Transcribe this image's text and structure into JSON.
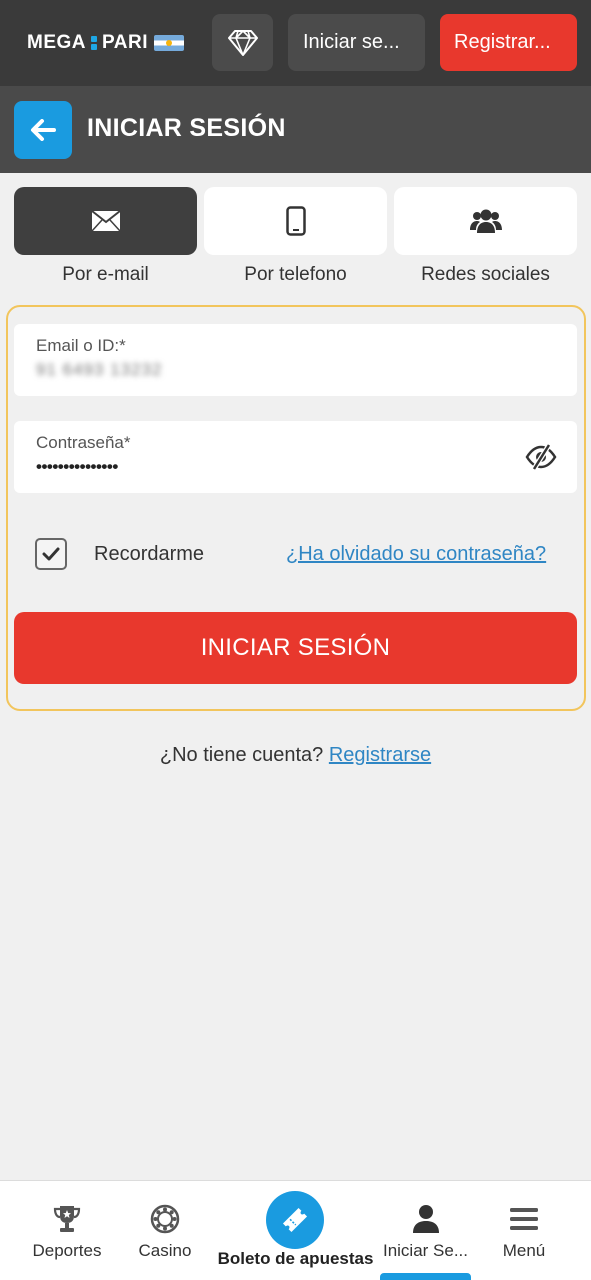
{
  "topbar": {
    "logo_left": "MEGA",
    "logo_right": "PARI",
    "login_label": "Iniciar se...",
    "register_label": "Registrar..."
  },
  "header": {
    "title": "INICIAR SESIÓN"
  },
  "tabs": [
    {
      "label": "Por e-mail",
      "icon": "envelope-icon",
      "active": true
    },
    {
      "label": "Por telefono",
      "icon": "phone-icon",
      "active": false
    },
    {
      "label": "Redes sociales",
      "icon": "users-icon",
      "active": false
    }
  ],
  "form": {
    "email_label": "Email o ID:*",
    "email_value": "91 6493 13232",
    "password_label": "Contraseña*",
    "password_value": "•••••••••••••••",
    "remember_label": "Recordarme",
    "remember_checked": true,
    "forgot_link": "¿Ha olvidado su contraseña?",
    "submit_label": "INICIAR SESIÓN"
  },
  "signup": {
    "prompt": "¿No tiene cuenta?",
    "link": "Registrarse"
  },
  "bottom_nav": {
    "items": [
      {
        "label": "Deportes",
        "icon": "trophy-icon"
      },
      {
        "label": "Casino",
        "icon": "casino-chip-icon"
      },
      {
        "label": "Boleto de apuestas",
        "icon": "ticket-icon"
      },
      {
        "label": "Iniciar Se...",
        "icon": "user-icon",
        "active": true
      },
      {
        "label": "Menú",
        "icon": "menu-icon"
      }
    ]
  },
  "colors": {
    "accent_blue": "#1a9be0",
    "accent_red": "#e8382d",
    "form_border": "#f2c55c",
    "link": "#2f86c4"
  }
}
